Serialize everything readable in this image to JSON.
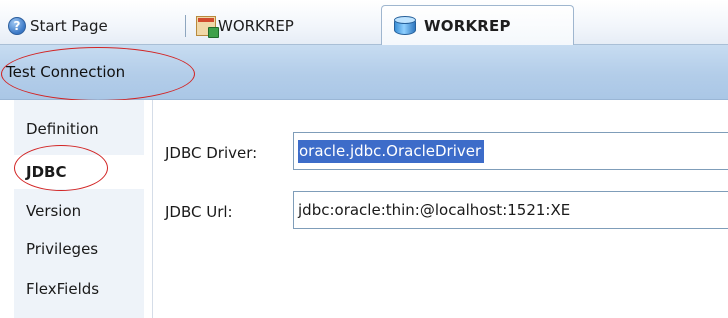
{
  "tabs": [
    {
      "label": "Start Page",
      "icon": "help-icon"
    },
    {
      "label": "WORKREP",
      "icon": "table-icon"
    },
    {
      "label": "WORKREP",
      "icon": "database-icon",
      "active": true
    }
  ],
  "toolbar": {
    "test_connection_label": "Test Connection"
  },
  "nav": {
    "items": [
      {
        "label": "Definition"
      },
      {
        "label": "JDBC",
        "active": true
      },
      {
        "label": "Version"
      },
      {
        "label": "Privileges"
      },
      {
        "label": "FlexFields"
      }
    ]
  },
  "form": {
    "driver": {
      "label": "JDBC Driver:",
      "value": "oracle.jdbc.OracleDriver"
    },
    "url": {
      "label": "JDBC Url:",
      "value": "jdbc:oracle:thin:@localhost:1521:XE"
    }
  },
  "colors": {
    "highlight_ellipse": "#d22525",
    "selection": "#3d6cc9",
    "toolbar_bg": "#b3cde9"
  }
}
